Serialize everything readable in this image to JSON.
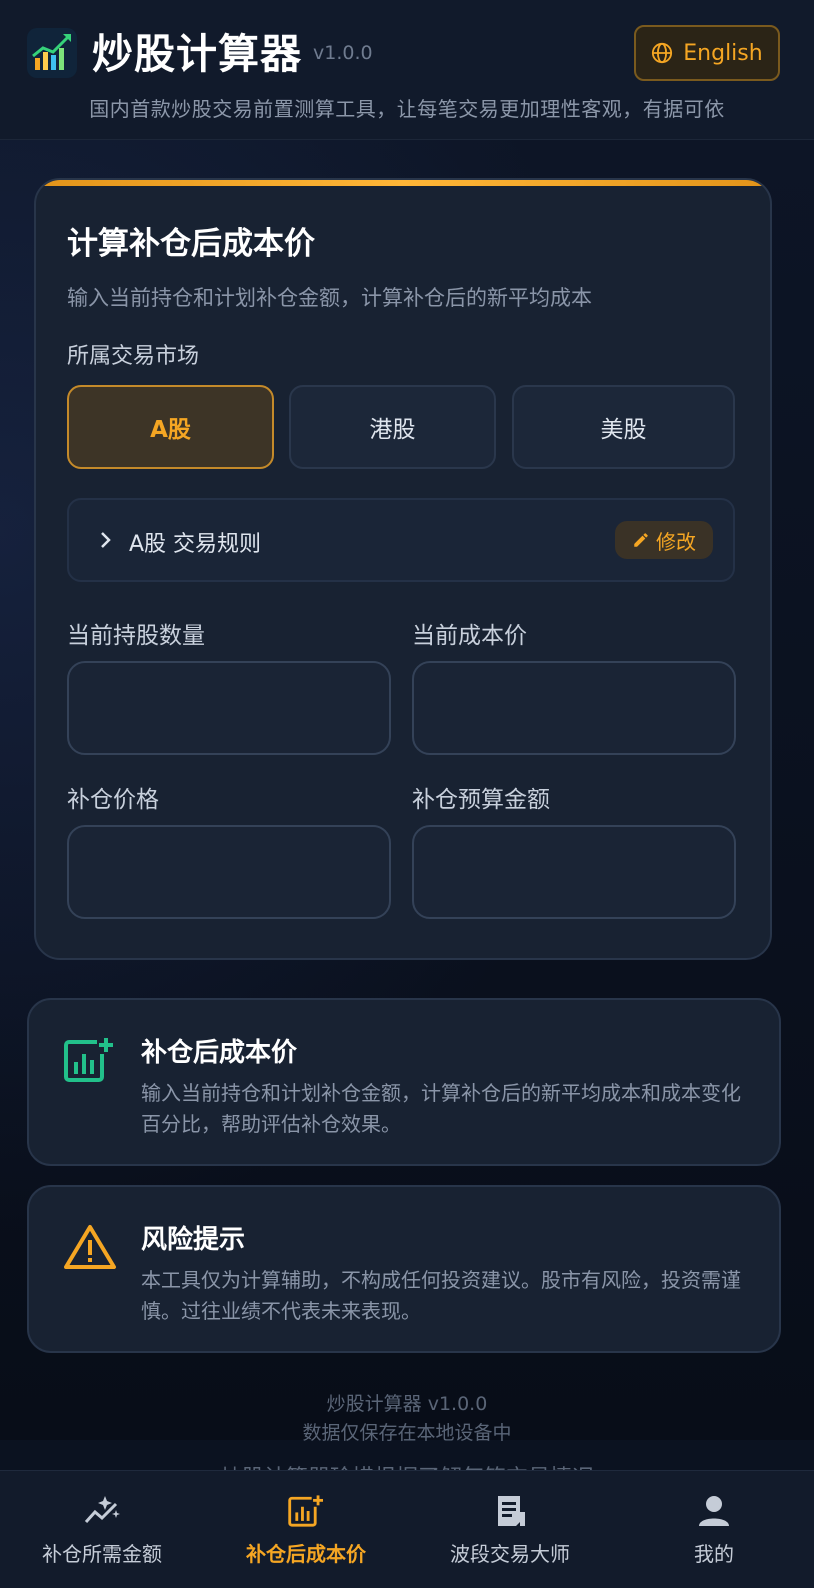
{
  "header": {
    "title": "炒股计算器",
    "version": "v1.0.0",
    "language_button": "English",
    "subtitle": "国内首款炒股交易前置测算工具，让每笔交易更加理性客观，有据可依"
  },
  "card": {
    "title": "计算补仓后成本价",
    "description": "输入当前持仓和计划补仓金额，计算补仓后的新平均成本",
    "market_label": "所属交易市场",
    "markets": [
      "A股",
      "港股",
      "美股"
    ],
    "selected_market": "A股",
    "rules_label": "A股 交易规则",
    "edit_label": "修改",
    "fields": {
      "shares_label": "当前持股数量",
      "shares_value": "",
      "cost_label": "当前成本价",
      "cost_value": "",
      "add_price_label": "补仓价格",
      "add_price_value": "",
      "budget_label": "补仓预算金额",
      "budget_value": ""
    }
  },
  "info_cost": {
    "title": "补仓后成本价",
    "text": "输入当前持仓和计划补仓金额，计算补仓后的新平均成本和成本变化百分比，帮助评估补仓效果。",
    "icon": "bar-chart-plus-icon",
    "color": "#22c08a"
  },
  "info_risk": {
    "title": "风险提示",
    "text": "本工具仅为计算辅助，不构成任何投资建议。股市有风险，投资需谨慎。过往业绩不代表未来表现。",
    "icon": "warning-icon",
    "color": "#f5a623"
  },
  "footer": {
    "line1": "炒股计算器 v1.0.0",
    "line2": "数据仅保存在本地设备中",
    "line3": "炒股计算器珍惜根据了解每笔交易情况"
  },
  "nav": {
    "items": [
      {
        "label": "补仓所需金额",
        "icon": "sparkle-chart-icon"
      },
      {
        "label": "补仓后成本价",
        "icon": "bar-chart-plus-icon"
      },
      {
        "label": "波段交易大师",
        "icon": "receipt-icon"
      },
      {
        "label": "我的",
        "icon": "user-icon"
      }
    ],
    "active_index": 1
  },
  "colors": {
    "accent": "#f5a623",
    "background": "#0b1220",
    "card": "#182232"
  }
}
